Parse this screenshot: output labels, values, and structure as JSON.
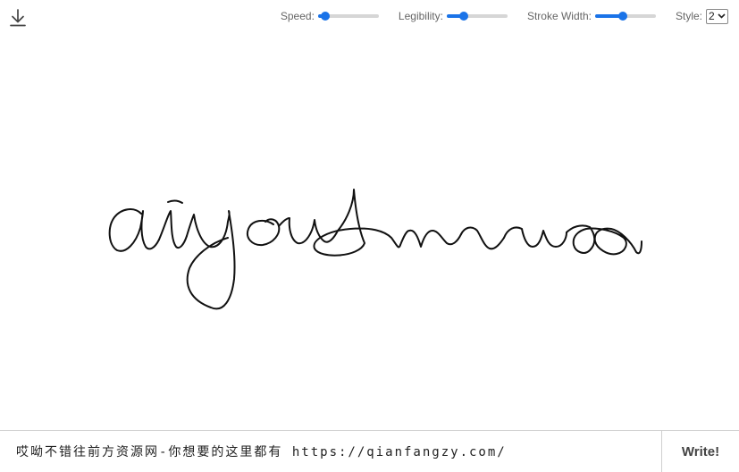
{
  "toolbar": {
    "download_icon": "download-icon",
    "speed": {
      "label": "Speed:",
      "value": 0.12
    },
    "legibility": {
      "label": "Legibility:",
      "value": 0.28
    },
    "stroke_width": {
      "label": "Stroke Width:",
      "value": 0.45
    },
    "style": {
      "label": "Style:",
      "value": "2",
      "icon": "chevron-down-icon"
    }
  },
  "canvas": {
    "stroke_color": "#111111"
  },
  "input": {
    "value": "哎呦不错往前方资源网-你想要的这里都有 https://qianfangzy.com/"
  },
  "write_button": {
    "label": "Write!"
  },
  "colors": {
    "accent": "#1a73e8",
    "track": "#d6d6d6"
  }
}
